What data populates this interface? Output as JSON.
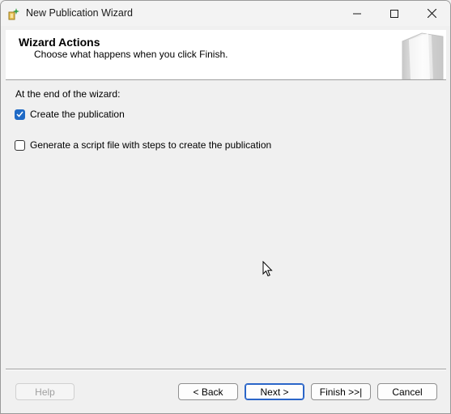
{
  "window": {
    "title": "New Publication Wizard",
    "icon": "wizard-app-icon"
  },
  "header": {
    "title": "Wizard Actions",
    "subtitle": "Choose what happens when you click Finish."
  },
  "content": {
    "section_label": "At the end of the wizard:",
    "options": [
      {
        "label": "Create the publication",
        "checked": true
      },
      {
        "label": "Generate a script file with steps to create the publication",
        "checked": false
      }
    ]
  },
  "buttons": {
    "help": "Help",
    "back": "< Back",
    "next": "Next >",
    "finish": "Finish >>|",
    "cancel": "Cancel"
  },
  "colors": {
    "accent": "#1f6ac6",
    "window_bg": "#f0f0f0",
    "header_bg": "#ffffff"
  }
}
